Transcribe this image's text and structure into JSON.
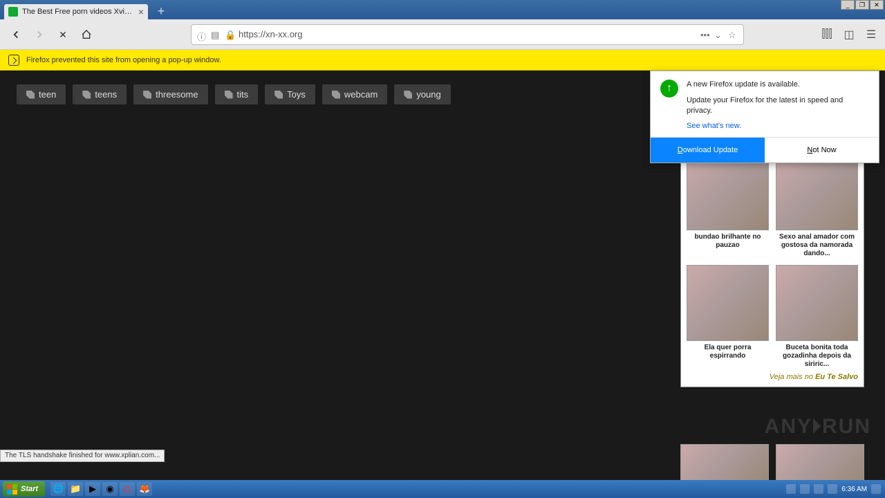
{
  "tab": {
    "title": "The Best Free porn videos Xvideos"
  },
  "url": "https://xn-xx.org",
  "infobar": {
    "message": "Firefox prevented this site from opening a pop-up window."
  },
  "tags": [
    "teen",
    "teens",
    "threesome",
    "tits",
    "Toys",
    "webcam",
    "young"
  ],
  "popup": {
    "heading": "A new Firefox update is available.",
    "body": "Update your Firefox for the latest in speed and privacy.",
    "link": "See what's new.",
    "primary_prefix": "D",
    "primary_rest": "ownload Update",
    "secondary_prefix": "N",
    "secondary_rest": "ot Now"
  },
  "ads": {
    "items": [
      {
        "caption": "bundao brilhante no pauzao"
      },
      {
        "caption": "Sexo anal amador com gostosa da namorada dando..."
      },
      {
        "caption": "Ela quer porra espirrando"
      },
      {
        "caption": "Buceta bonita toda gozadinha depois da siriric..."
      }
    ],
    "footer_prefix": "Veja mais no ",
    "footer_bold": "Eu Te Salvo"
  },
  "watermark": "ANY🞂RUN",
  "status": "The TLS handshake finished for www.xplian.com...",
  "taskbar": {
    "start": "Start",
    "time": "6:36 AM"
  }
}
